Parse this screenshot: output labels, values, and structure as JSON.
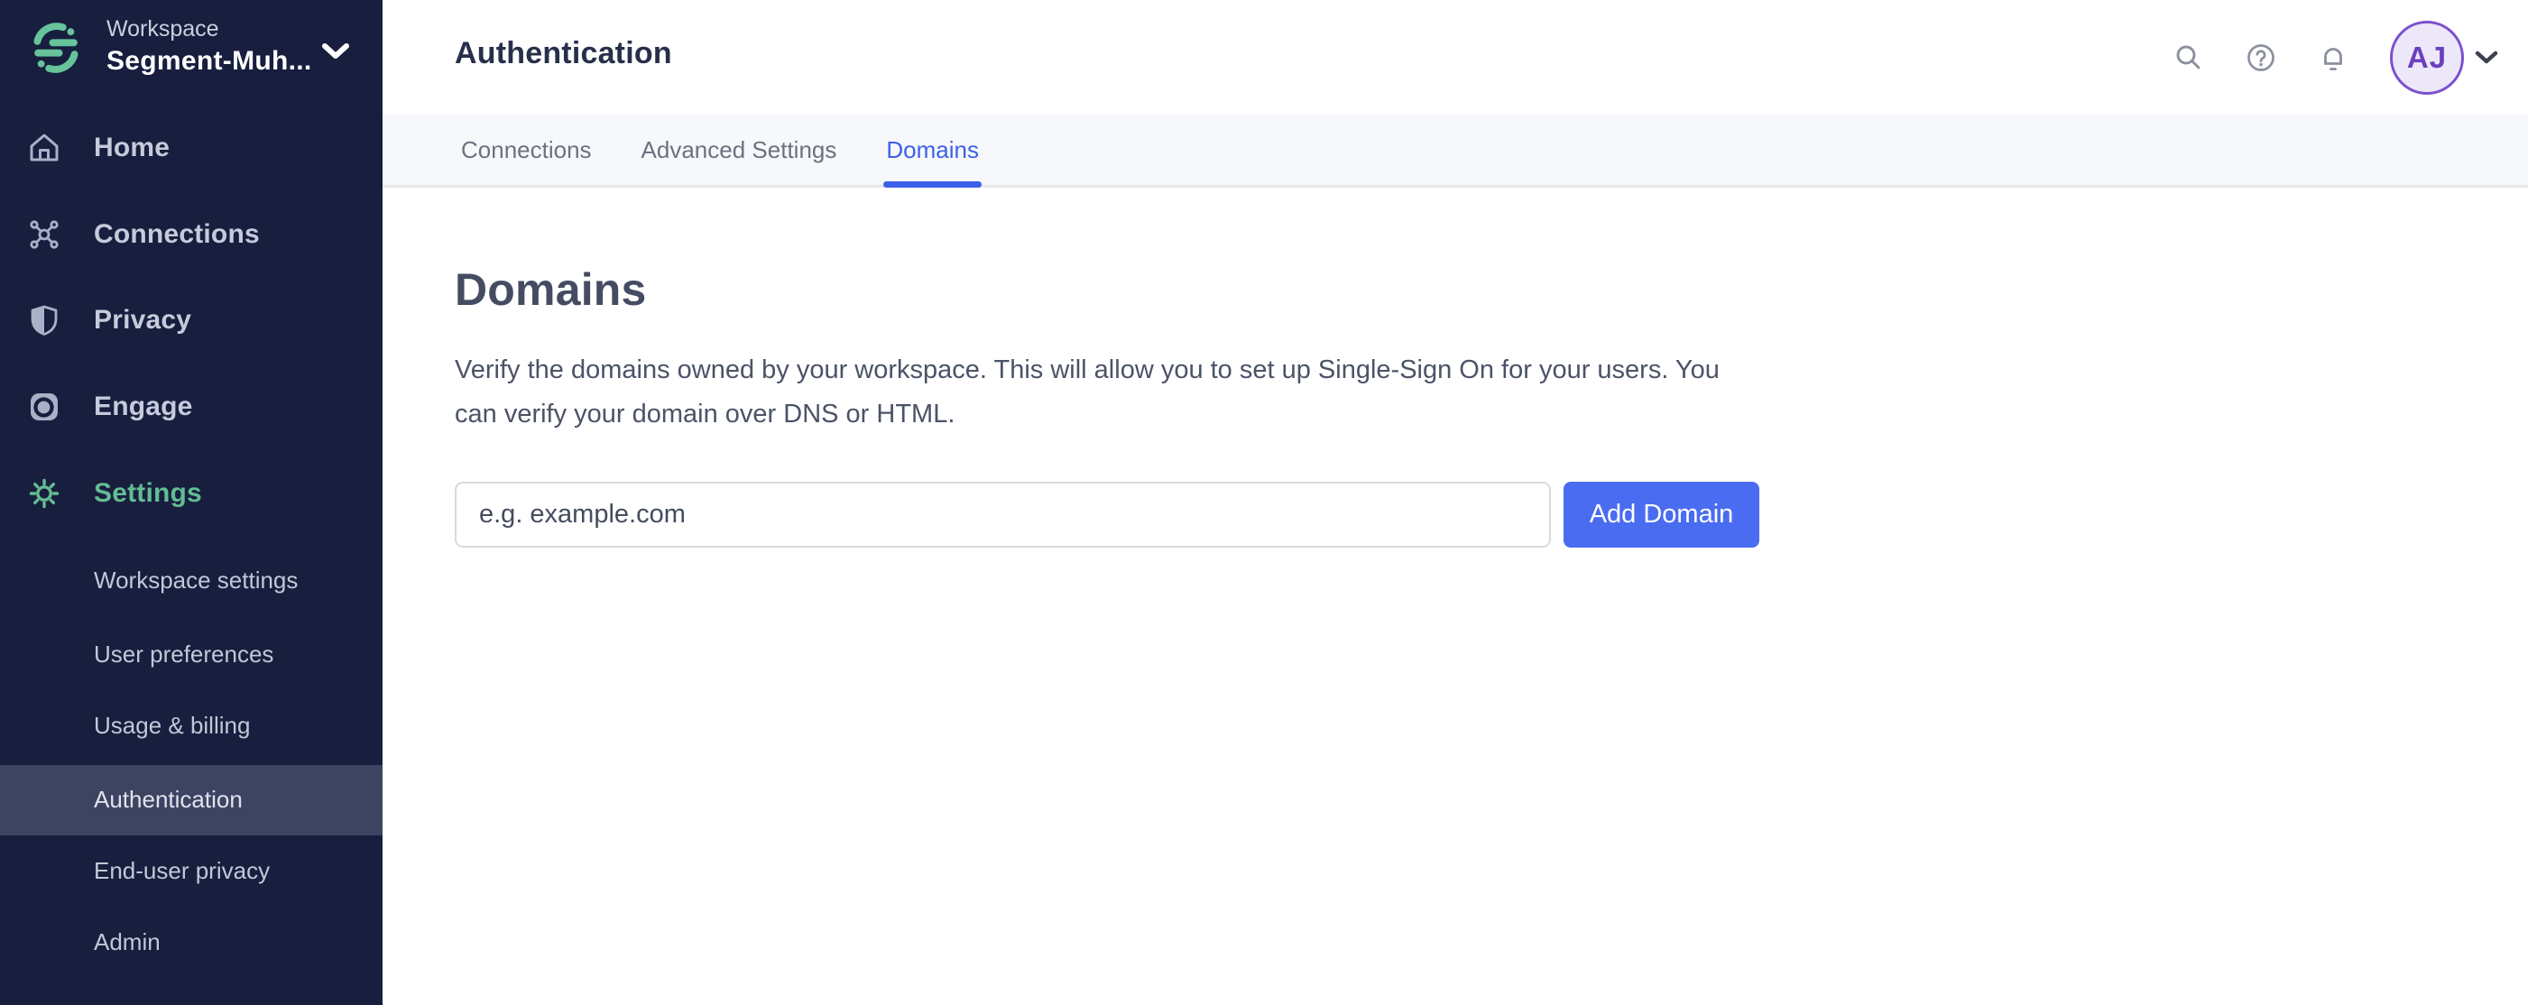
{
  "colors": {
    "sidebar_bg": "#171E3E",
    "sidebar_highlight": "#3D4462",
    "brand_green": "#67C39A",
    "settings_green": "#63BD92",
    "tab_active_blue": "#3D60E8",
    "button_blue": "#4A6CF0",
    "avatar_purple": "#6B40BE",
    "avatar_bg": "#EDE8F9"
  },
  "workspace": {
    "label": "Workspace",
    "name": "Segment-Muh...",
    "logo_icon": "segment-logo",
    "chevron_icon": "chevron-down-icon"
  },
  "sidebar": {
    "items": [
      {
        "label": "Home",
        "icon": "home-icon",
        "active": false
      },
      {
        "label": "Connections",
        "icon": "connections-icon",
        "active": false
      },
      {
        "label": "Privacy",
        "icon": "shield-icon",
        "active": false
      },
      {
        "label": "Engage",
        "icon": "engage-icon",
        "active": false
      },
      {
        "label": "Settings",
        "icon": "gear-icon",
        "active": true
      }
    ],
    "settings_sub_items": [
      {
        "label": "Workspace settings",
        "selected": false
      },
      {
        "label": "User preferences",
        "selected": false
      },
      {
        "label": "Usage & billing",
        "selected": false
      },
      {
        "label": "Authentication",
        "selected": true
      },
      {
        "label": "End-user privacy",
        "selected": false
      },
      {
        "label": "Admin",
        "selected": false
      }
    ]
  },
  "header": {
    "title": "Authentication",
    "tabs": [
      {
        "label": "Connections",
        "active": false
      },
      {
        "label": "Advanced Settings",
        "active": false
      },
      {
        "label": "Domains",
        "active": true
      }
    ],
    "icons": [
      "search-icon",
      "help-icon",
      "notifications-bell-icon"
    ],
    "user": {
      "initials": "AJ"
    }
  },
  "main": {
    "heading": "Domains",
    "description": "Verify the domains owned by your workspace. This will allow you to set up Single-Sign On for your users. You can verify your domain over DNS or HTML.",
    "domain_input": {
      "value": "",
      "placeholder": "e.g. example.com"
    },
    "add_button_label": "Add Domain"
  }
}
